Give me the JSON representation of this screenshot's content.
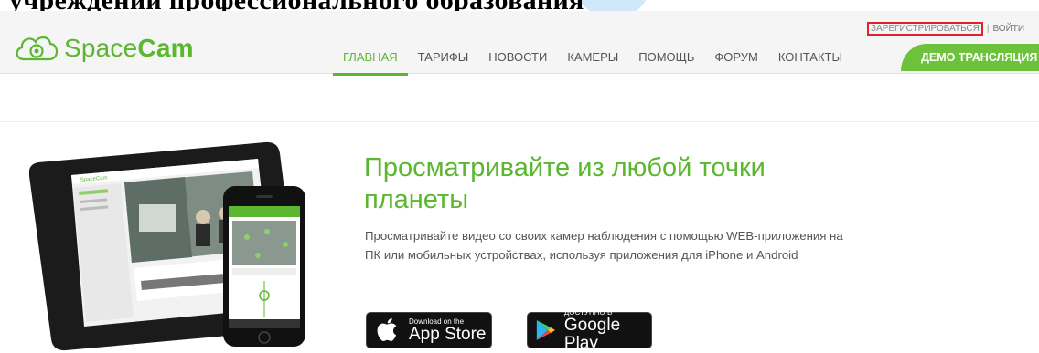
{
  "page_heading": "учреждении профессионального образования",
  "logo": {
    "text_light": "Space",
    "text_bold": "Cam"
  },
  "auth": {
    "register": "ЗАРЕГИСТРИРОВАТЬСЯ",
    "separator": "|",
    "login": "ВОЙТИ"
  },
  "nav": {
    "items": [
      "ГЛАВНАЯ",
      "ТАРИФЫ",
      "НОВОСТИ",
      "КАМЕРЫ",
      "ПОМОЩЬ",
      "ФОРУМ",
      "КОНТАКТЫ"
    ],
    "active_index": 0,
    "demo_label": "ДЕМО ТРАНСЛЯЦИЯ"
  },
  "hero": {
    "headline": "Просматривайте из любой точки планеты",
    "description": "Просматривайте видео со своих камер наблюдения с помощью WEB-приложения на ПК или мобильных устройствах, используя приложения для iPhone и Android"
  },
  "stores": {
    "apple": {
      "small": "Download on the",
      "big": "App Store"
    },
    "google": {
      "small": "ДОСТУПНО В",
      "big": "Google Play"
    }
  },
  "colors": {
    "accent": "#5ab72f",
    "demo": "#6cc23a",
    "highlight": "#e2212c"
  }
}
